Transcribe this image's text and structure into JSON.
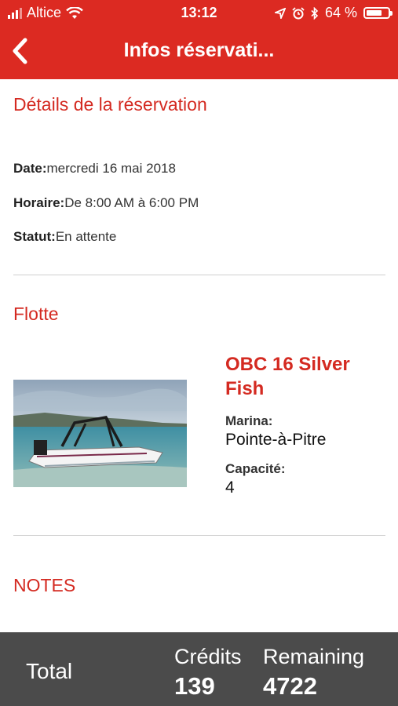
{
  "status_bar": {
    "carrier": "Altice",
    "time": "13:12",
    "battery": "64 %"
  },
  "nav": {
    "title": "Infos réservati..."
  },
  "reservation": {
    "title": "Détails de la réservation",
    "date_label": "Date:",
    "date_value": "mercredi 16 mai 2018",
    "schedule_label": "Horaire:",
    "schedule_value": "De 8:00 AM à 6:00 PM",
    "status_label": "Statut:",
    "status_value": "En attente"
  },
  "fleet": {
    "title": "Flotte",
    "boat_name": "OBC 16 Silver Fish",
    "marina_label": "Marina:",
    "marina_value": "Pointe-à-Pitre",
    "capacity_label": "Capacité:",
    "capacity_value": "4"
  },
  "notes": {
    "title": "NOTES"
  },
  "footer": {
    "total_label": "Total",
    "credits_label": "Crédits",
    "credits_value": "139",
    "remaining_label": "Remaining",
    "remaining_value": "4722"
  },
  "colors": {
    "accent": "#dc2a22",
    "footer_bg": "#4b4b4b"
  }
}
